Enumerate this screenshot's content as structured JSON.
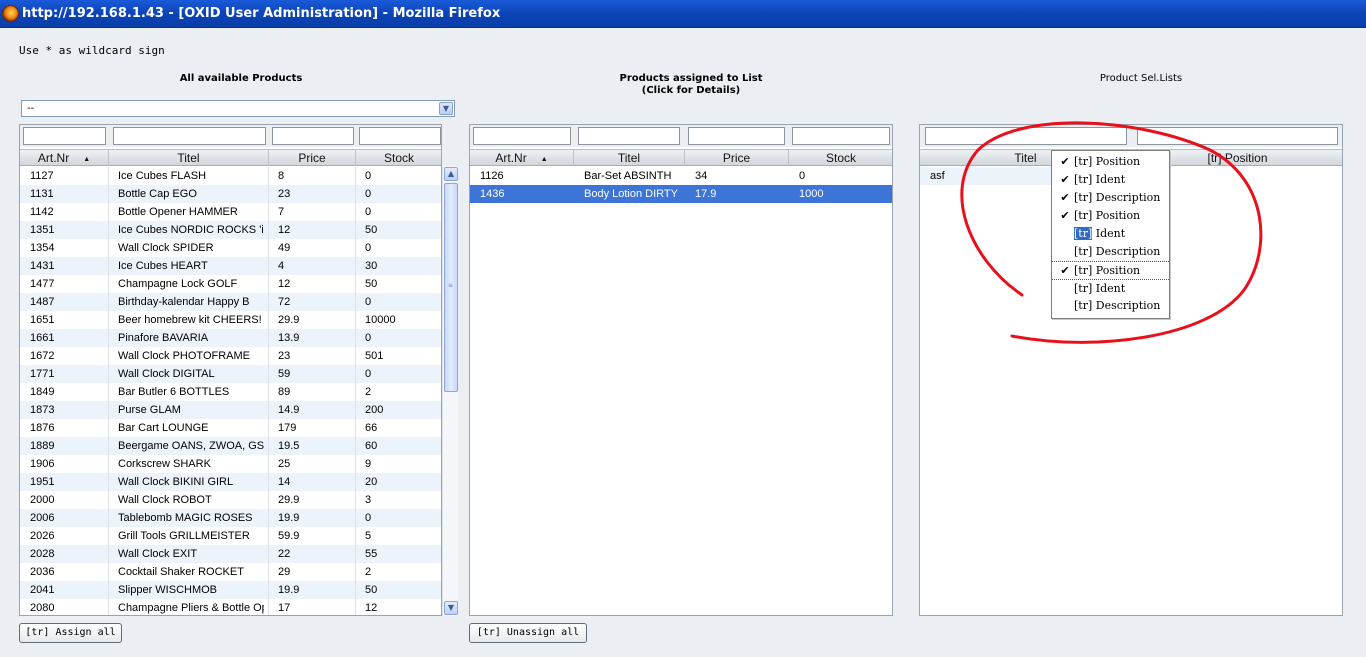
{
  "window": {
    "title": "http://192.168.1.43 - [OXID User Administration] - Mozilla Firefox"
  },
  "hint": "Use * as wildcard sign",
  "left_panel": {
    "title": "All available Products",
    "dropdown_value": "--",
    "columns": [
      "Art.Nr",
      "Titel",
      "Price",
      "Stock"
    ],
    "rows": [
      [
        "1127",
        "Ice Cubes FLASH",
        "8",
        "0"
      ],
      [
        "1131",
        "Bottle Cap EGO",
        "23",
        "0"
      ],
      [
        "1142",
        "Bottle Opener HAMMER",
        "7",
        "0"
      ],
      [
        "1351",
        "Ice Cubes NORDIC ROCKS 'ic",
        "12",
        "50"
      ],
      [
        "1354",
        "Wall Clock SPIDER",
        "49",
        "0"
      ],
      [
        "1431",
        "Ice Cubes HEART",
        "4",
        "30"
      ],
      [
        "1477",
        "Champagne Lock GOLF",
        "12",
        "50"
      ],
      [
        "1487",
        "Birthday-kalendar Happy B",
        "72",
        "0"
      ],
      [
        "1651",
        "Beer homebrew kit CHEERS!",
        "29.9",
        "10000"
      ],
      [
        "1661",
        "Pinafore BAVARIA",
        "13.9",
        "0"
      ],
      [
        "1672",
        "Wall Clock PHOTOFRAME",
        "23",
        "501"
      ],
      [
        "1771",
        "Wall Clock DIGITAL",
        "59",
        "0"
      ],
      [
        "1849",
        "Bar Butler 6 BOTTLES",
        "89",
        "2"
      ],
      [
        "1873",
        "Purse GLAM",
        "14.9",
        "200"
      ],
      [
        "1876",
        "Bar Cart LOUNGE",
        "179",
        "66"
      ],
      [
        "1889",
        "Beergame OANS, ZWOA, GS",
        "19.5",
        "60"
      ],
      [
        "1906",
        "Corkscrew SHARK",
        "25",
        "9"
      ],
      [
        "1951",
        "Wall Clock BIKINI GIRL",
        "14",
        "20"
      ],
      [
        "2000",
        "Wall Clock ROBOT",
        "29.9",
        "3"
      ],
      [
        "2006",
        "Tablebomb MAGIC ROSES",
        "19.9",
        "0"
      ],
      [
        "2026",
        "Grill Tools GRILLMEISTER",
        "59.9",
        "5"
      ],
      [
        "2028",
        "Wall Clock EXIT",
        "22",
        "55"
      ],
      [
        "2036",
        "Cocktail Shaker ROCKET",
        "29",
        "2"
      ],
      [
        "2041",
        "Slipper WISCHMOB",
        "19.9",
        "50"
      ],
      [
        "2080",
        "Champagne Pliers & Bottle Op",
        "17",
        "12"
      ]
    ],
    "button": "[tr] Assign all"
  },
  "middle_panel": {
    "title": "Products assigned to List",
    "subtitle": "(Click for Details)",
    "columns": [
      "Art.Nr",
      "Titel",
      "Price",
      "Stock"
    ],
    "rows": [
      [
        "1126",
        "Bar-Set ABSINTH",
        "34",
        "0"
      ],
      [
        "1436",
        "Body Lotion DIRTY",
        "17.9",
        "1000"
      ]
    ],
    "button": "[tr] Unassign all"
  },
  "right_panel": {
    "title": "Product Sel.Lists",
    "columns": [
      "Titel",
      "[tr] Position"
    ],
    "rows": [
      [
        "asf",
        ""
      ]
    ]
  },
  "context_menu": {
    "items": [
      {
        "pre": "",
        "label": "[tr] Position",
        "checked": "✔"
      },
      {
        "pre": "",
        "label": "[tr] Ident",
        "checked": "✔"
      },
      {
        "pre": "",
        "label": "[tr] Description",
        "checked": "✔"
      },
      {
        "pre": "",
        "label": "[tr] Position",
        "checked": "✔"
      },
      {
        "pre": "[tr]",
        "label": " Ident",
        "checked": ""
      },
      {
        "pre": "",
        "label": "[tr] Description",
        "checked": ""
      },
      {
        "pre": "",
        "label": "[tr] Position",
        "checked": "✔"
      },
      {
        "pre": "",
        "label": "[tr] Ident",
        "checked": ""
      },
      {
        "pre": "",
        "label": "[tr] Description",
        "checked": ""
      }
    ]
  },
  "colors": {
    "selection": "#3d74d8",
    "annotation": "#e8101a"
  }
}
